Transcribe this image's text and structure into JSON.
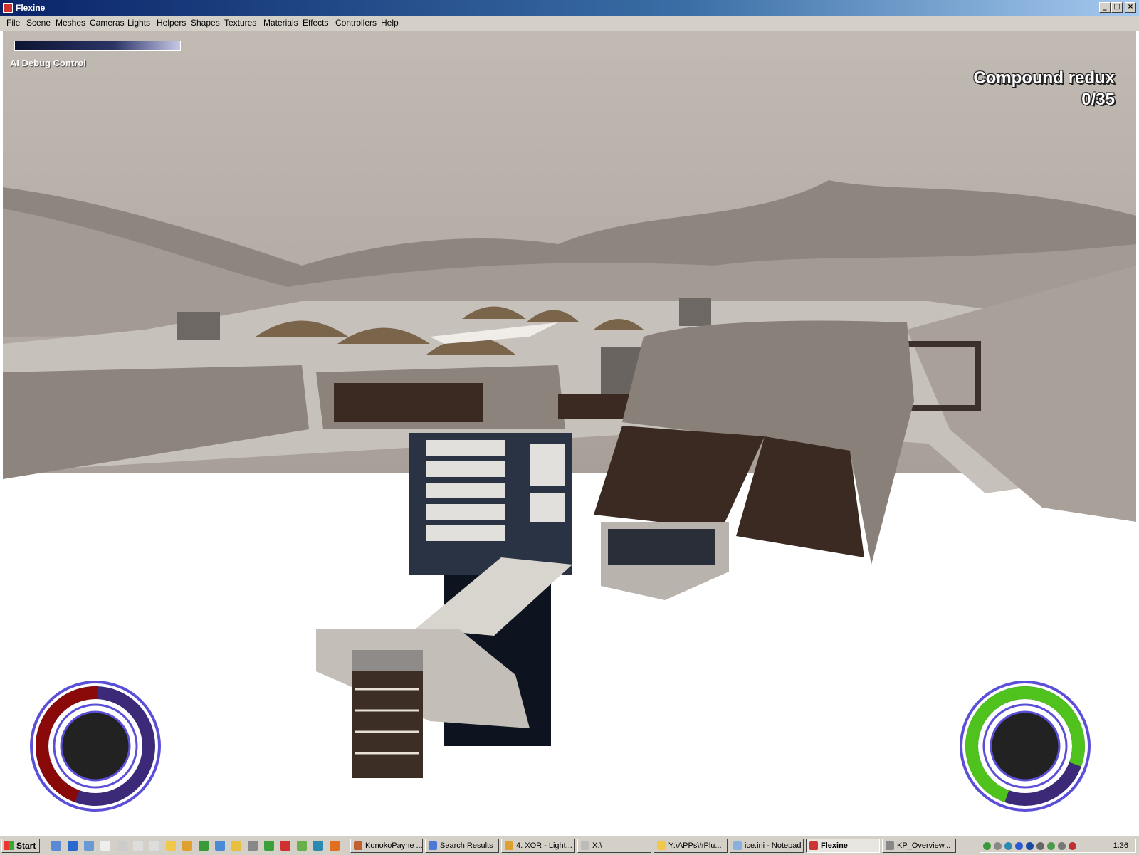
{
  "window": {
    "title": "Flexine"
  },
  "menu": [
    "File",
    "Scene",
    "Meshes",
    "Cameras",
    "Lights",
    "Helpers",
    "Shapes",
    "Textures",
    "Materials",
    "Effects",
    "Controllers",
    "Help"
  ],
  "viewport": {
    "debug_label": "AI Debug Control",
    "level_name": "Compound redux",
    "counter": "0/35"
  },
  "hud_left": {
    "health_fraction": 0.45
  },
  "hud_right": {
    "health_fraction": 0.75
  },
  "taskbar": {
    "start": "Start",
    "tasks": [
      "KonokoPayne ...",
      "Search Results",
      "4. XOR - Light...",
      "X:\\",
      "Y:\\APPs\\#Plu...",
      "ice.ini - Notepad",
      "Flexine",
      "KP_Overview..."
    ],
    "active_task": "Flexine",
    "clock": "1:36"
  },
  "colors": {
    "title_start": "#0a246a",
    "title_end": "#a6caf0",
    "ring": "#5a4fd6",
    "hud_red": "#8a0a0a",
    "hud_green": "#4fc21e"
  }
}
